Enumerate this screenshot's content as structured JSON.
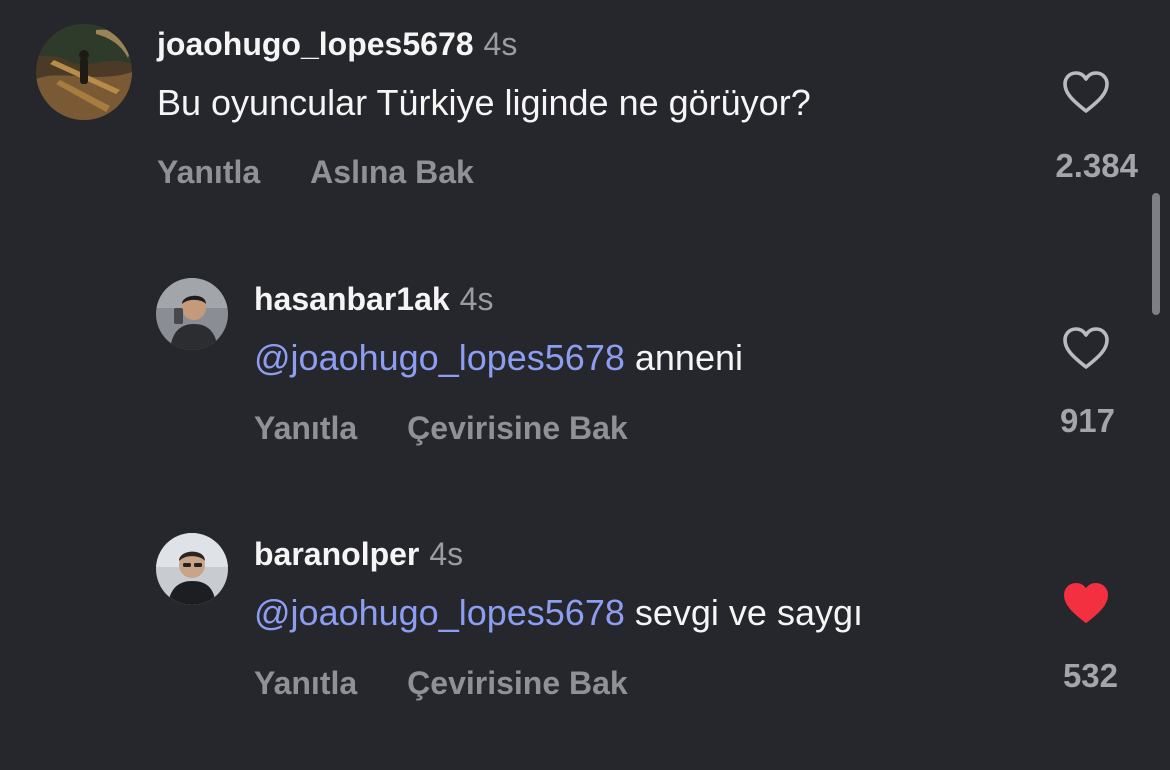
{
  "comments": [
    {
      "username": "joaohugo_lopes5678",
      "time": "4s",
      "mention": "",
      "text": "Bu oyuncular Türkiye liginde ne görüyor?",
      "reply_label": "Yanıtla",
      "translate_label": "Aslına Bak",
      "likes": "2.384",
      "liked": false
    },
    {
      "username": "hasanbar1ak",
      "time": "4s",
      "mention": "@joaohugo_lopes5678",
      "text": "anneni",
      "reply_label": "Yanıtla",
      "translate_label": "Çevirisine Bak",
      "likes": "917",
      "liked": false
    },
    {
      "username": "baranolper",
      "time": "4s",
      "mention": "@joaohugo_lopes5678",
      "text": "sevgi ve saygı",
      "reply_label": "Yanıtla",
      "translate_label": "Çevirisine Bak",
      "likes": "532",
      "liked": true
    }
  ],
  "icons": {
    "like_outline": "heart-outline-icon",
    "like_filled": "heart-filled-icon"
  },
  "colors": {
    "background": "#26272c",
    "mention": "#8d9df2",
    "liked_heart": "#f3303f",
    "muted_text": "#8f9197"
  }
}
